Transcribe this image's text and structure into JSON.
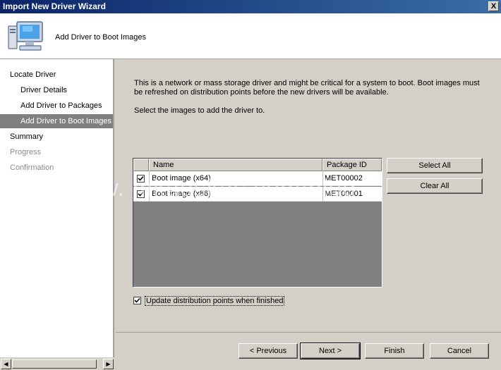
{
  "window": {
    "title": "Import New Driver Wizard",
    "close_label": "X"
  },
  "header": {
    "title": "Add Driver to Boot Images",
    "icon": "computer-icon"
  },
  "sidebar": {
    "items": [
      {
        "label": "Locate Driver",
        "state": "normal"
      },
      {
        "label": "Driver Details",
        "state": "normal"
      },
      {
        "label": "Add Driver to Packages",
        "state": "normal"
      },
      {
        "label": "Add Driver to Boot Images",
        "state": "selected"
      },
      {
        "label": "Summary",
        "state": "normal"
      },
      {
        "label": "Progress",
        "state": "disabled"
      },
      {
        "label": "Confirmation",
        "state": "disabled"
      }
    ]
  },
  "main": {
    "description": "This is a network or mass storage driver and might be critical for a system to boot.  Boot images must be refreshed on distribution points before the new drivers will be available.",
    "instruction": "Select the images to add the driver to.",
    "table": {
      "columns": [
        "Name",
        "Package ID"
      ],
      "rows": [
        {
          "checked": true,
          "name": "Boot image (x64)",
          "package_id": "MET00002"
        },
        {
          "checked": true,
          "name": "Boot image (x86)",
          "package_id": "MET00001"
        }
      ]
    },
    "select_all_label": "Select All",
    "clear_all_label": "Clear All",
    "update_dp": {
      "checked": true,
      "label": "Update distribution points when finished"
    }
  },
  "footer": {
    "previous_label": "< Previous",
    "next_label": "Next >",
    "finish_label": "Finish",
    "cancel_label": "Cancel"
  },
  "watermark": "www.    mkauskas.com/blog"
}
